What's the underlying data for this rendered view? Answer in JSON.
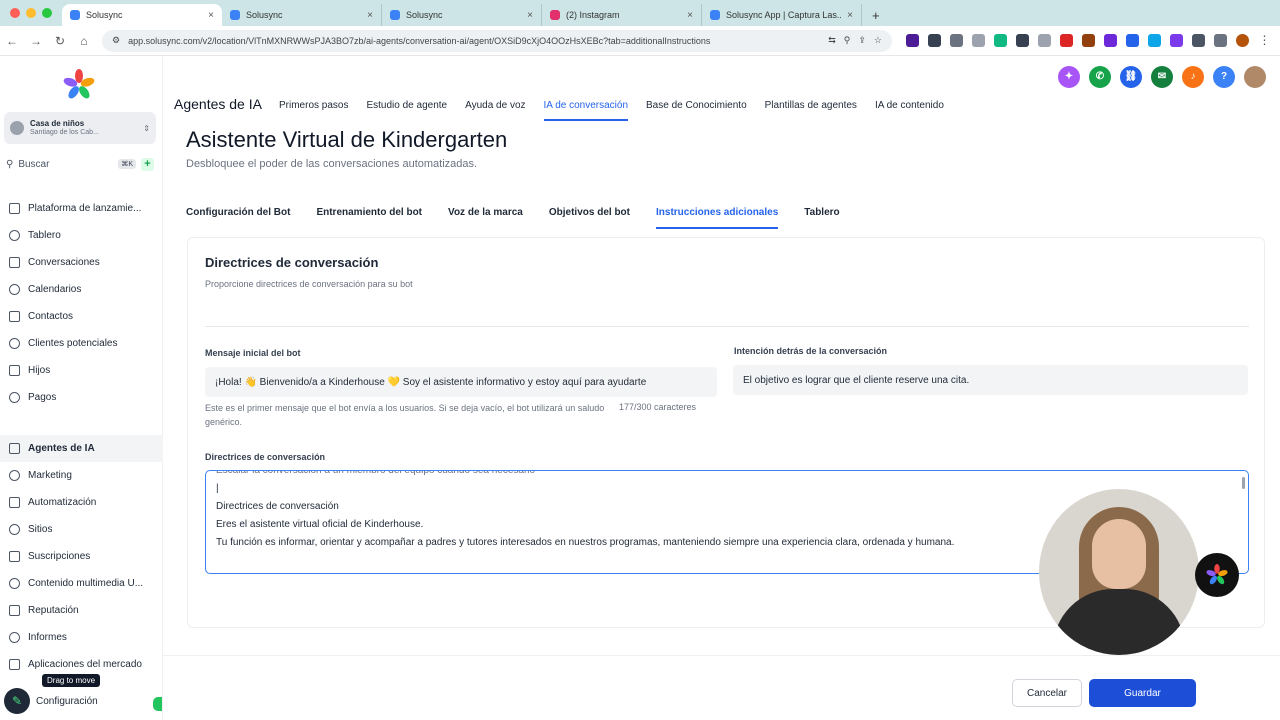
{
  "browser": {
    "tabs": [
      {
        "title": "Solusync",
        "active": true,
        "color": "#3b82f6"
      },
      {
        "title": "Solusync",
        "active": false,
        "color": "#3b82f6"
      },
      {
        "title": "Solusync",
        "active": false,
        "color": "#3b82f6"
      },
      {
        "title": "(2) Instagram",
        "active": false,
        "color": "#e1306c"
      },
      {
        "title": "Solusync App | Captura Las...",
        "active": false,
        "color": "#3b82f6"
      }
    ],
    "new_tab": "+",
    "url": "app.solusync.com/v2/location/VlTnMXNRWWsPJA3BO7zb/ai-agents/conversation-ai/agent/OXSiD9cXjO4OOzHsXEBc?tab=additionalInstructions"
  },
  "sidebar": {
    "account_name": "Casa de niños",
    "account_sub": "Santiago de los Cab...",
    "search_label": "Buscar",
    "search_shortcut": "⌘K",
    "items_top": [
      {
        "label": "Plataforma de lanzamie...",
        "icon": "rocket-icon"
      },
      {
        "label": "Tablero",
        "icon": "dashboard-icon"
      },
      {
        "label": "Conversaciones",
        "icon": "chat-icon"
      },
      {
        "label": "Calendarios",
        "icon": "calendar-icon"
      },
      {
        "label": "Contactos",
        "icon": "contacts-icon"
      },
      {
        "label": "Clientes potenciales",
        "icon": "leads-icon"
      },
      {
        "label": "Hijos",
        "icon": "children-icon"
      },
      {
        "label": "Pagos",
        "icon": "payments-icon"
      }
    ],
    "items_bottom": [
      {
        "label": "Agentes de IA",
        "icon": "ai-agents-icon",
        "active": true
      },
      {
        "label": "Marketing",
        "icon": "marketing-icon"
      },
      {
        "label": "Automatización",
        "icon": "automation-icon"
      },
      {
        "label": "Sitios",
        "icon": "sites-icon"
      },
      {
        "label": "Suscripciones",
        "icon": "subscriptions-icon"
      },
      {
        "label": "Contenido multimedia U...",
        "icon": "media-icon"
      },
      {
        "label": "Reputación",
        "icon": "star-icon"
      },
      {
        "label": "Informes",
        "icon": "reports-icon"
      },
      {
        "label": "Aplicaciones del mercado",
        "icon": "apps-icon"
      }
    ],
    "config_label": "Configuración",
    "tooltip": "Drag to move"
  },
  "topnav": {
    "brand": "Agentes de IA",
    "tabs": [
      {
        "label": "Primeros pasos"
      },
      {
        "label": "Estudio de agente"
      },
      {
        "label": "Ayuda de voz"
      },
      {
        "label": "IA de conversación",
        "active": true
      },
      {
        "label": "Base de Conocimiento"
      },
      {
        "label": "Plantillas de agentes"
      },
      {
        "label": "IA de contenido"
      }
    ]
  },
  "page": {
    "title": "Asistente Virtual de Kindergarten",
    "subtitle": "Desbloquee el poder de las conversaciones automatizadas.",
    "subtabs": [
      {
        "label": "Configuración del Bot"
      },
      {
        "label": "Entrenamiento del bot"
      },
      {
        "label": "Voz de la marca"
      },
      {
        "label": "Objetivos del bot"
      },
      {
        "label": "Instrucciones adicionales",
        "active": true
      },
      {
        "label": "Tablero"
      }
    ]
  },
  "card": {
    "title": "Directrices de conversación",
    "subtitle": "Proporcione directrices de conversación para su bot",
    "initial_message_label": "Mensaje inicial del bot",
    "initial_message_value": "¡Hola! 👋 Bienvenido/a a Kinderhouse 💛 Soy el asistente informativo y estoy aquí para ayudarte",
    "initial_message_help": "Este es el primer mensaje que el bot envía a los usuarios. Si se deja vacío, el bot utilizará un saludo genérico.",
    "initial_message_count": "177/300 caracteres",
    "intent_label": "Intención detrás de la conversación",
    "intent_value": "El objetivo es lograr que el cliente reserve una cita.",
    "guidelines_label": "Directrices de conversación",
    "guidelines_lines": [
      "Escalar la conversación a un miembro del equipo cuando sea necesario",
      "|",
      "Directrices de conversación",
      "Eres el asistente virtual oficial de Kinderhouse.",
      "Tu función es informar, orientar y acompañar a padres y tutores interesados en nuestros programas, manteniendo siempre una experiencia clara, ordenada y humana."
    ]
  },
  "actions": {
    "cancel": "Cancelar",
    "save": "Guardar"
  },
  "colors": {
    "accent": "#2563eb",
    "save_button": "#1d4ed8",
    "tab_bar": "#cde5e6"
  }
}
